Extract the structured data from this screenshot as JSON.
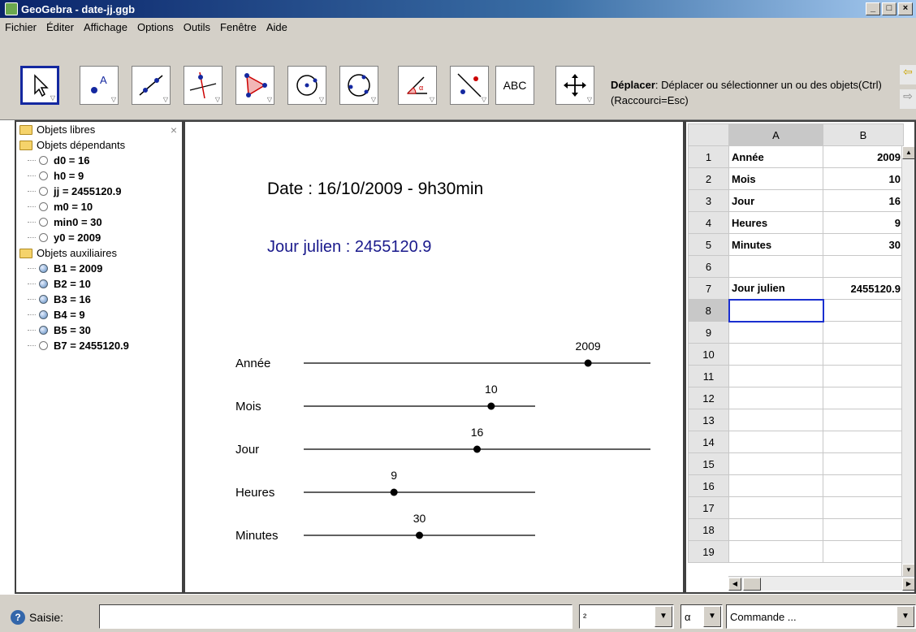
{
  "window": {
    "title": "GeoGebra - date-jj.ggb",
    "buttons": [
      "_",
      "□",
      "×"
    ]
  },
  "menu": [
    "Fichier",
    "Éditer",
    "Affichage",
    "Options",
    "Outils",
    "Fenêtre",
    "Aide"
  ],
  "toolbar": {
    "tools": [
      {
        "name": "move-tool-icon"
      },
      {
        "name": "point-tool-icon"
      },
      {
        "name": "line-tool-icon"
      },
      {
        "name": "perpendicular-tool-icon"
      },
      {
        "name": "polygon-tool-icon"
      },
      {
        "name": "circle-tool-icon"
      },
      {
        "name": "conic-tool-icon"
      },
      {
        "name": "angle-tool-icon"
      },
      {
        "name": "reflect-tool-icon"
      },
      {
        "name": "text-tool-icon",
        "label": "ABC"
      },
      {
        "name": "move-view-tool-icon"
      }
    ],
    "help_title": "Déplacer",
    "help_text": ": Déplacer ou sélectionner un ou des objets(Ctrl) (Raccourci=Esc)"
  },
  "algebra": {
    "close": "×",
    "free_folder": "Objets libres",
    "dependent_folder": "Objets dépendants",
    "dependent": [
      "d0 = 16",
      "h0 = 9",
      "jj = 2455120.9",
      "m0 = 10",
      "min0 = 30",
      "y0 = 2009"
    ],
    "aux_folder": "Objets auxiliaires",
    "auxiliary": [
      "B1 = 2009",
      "B2 = 10",
      "B3 = 16",
      "B4 = 9",
      "B5 = 30"
    ],
    "auxiliary_last": "B7 = 2455120.9"
  },
  "graphics": {
    "date_text": "Date :  16/10/2009 - 9h30min",
    "julian_text": "Jour julien : 2455120.9",
    "sliders": [
      {
        "label": "Année",
        "value": "2009",
        "fraction": 0.82
      },
      {
        "label": "Mois",
        "value": "10",
        "fraction": 0.81
      },
      {
        "label": "Jour",
        "value": "16",
        "fraction": 0.5
      },
      {
        "label": "Heures",
        "value": "9",
        "fraction": 0.39
      },
      {
        "label": "Minutes",
        "value": "30",
        "fraction": 0.5
      }
    ]
  },
  "sheet": {
    "columns": [
      "A",
      "B"
    ],
    "rows": [
      {
        "n": "1",
        "a": "Année",
        "b": "2009"
      },
      {
        "n": "2",
        "a": "Mois",
        "b": "10"
      },
      {
        "n": "3",
        "a": "Jour",
        "b": "16"
      },
      {
        "n": "4",
        "a": "Heures",
        "b": "9"
      },
      {
        "n": "5",
        "a": "Minutes",
        "b": "30"
      },
      {
        "n": "6",
        "a": "",
        "b": ""
      },
      {
        "n": "7",
        "a": "Jour julien",
        "b": "2455120.9"
      },
      {
        "n": "8",
        "a": "",
        "b": ""
      },
      {
        "n": "9",
        "a": "",
        "b": ""
      },
      {
        "n": "10",
        "a": "",
        "b": ""
      },
      {
        "n": "11",
        "a": "",
        "b": ""
      },
      {
        "n": "12",
        "a": "",
        "b": ""
      },
      {
        "n": "13",
        "a": "",
        "b": ""
      },
      {
        "n": "14",
        "a": "",
        "b": ""
      },
      {
        "n": "15",
        "a": "",
        "b": ""
      },
      {
        "n": "16",
        "a": "",
        "b": ""
      },
      {
        "n": "17",
        "a": "",
        "b": ""
      },
      {
        "n": "18",
        "a": "",
        "b": ""
      },
      {
        "n": "19",
        "a": "",
        "b": ""
      }
    ],
    "active_row": "8"
  },
  "inputbar": {
    "label": "Saisie:",
    "symbol_combo": "²",
    "greek_combo": "α",
    "command_placeholder": "Commande ..."
  },
  "colors": {
    "slider_line": "#000000",
    "julian_text": "#1a1a8c",
    "selection": "#1a2fd0"
  }
}
